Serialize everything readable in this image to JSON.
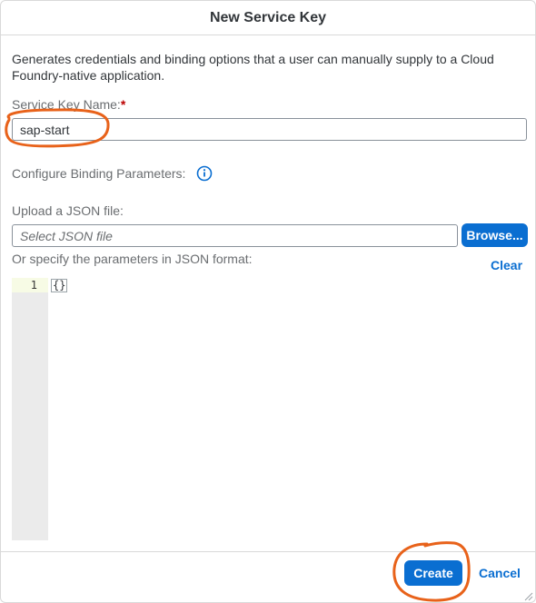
{
  "dialog": {
    "title": "New Service Key",
    "description": "Generates credentials and binding options that a user can manually supply to a Cloud Foundry-native application.",
    "service_key_name_label": "Service Key Name:",
    "required_marker": "*",
    "service_key_name_value": "sap-start",
    "binding_params_label": "Configure Binding Parameters:",
    "upload_label": "Upload a JSON file:",
    "file_placeholder": "Select JSON file",
    "browse_button": "Browse...",
    "specify_label": "Or specify the parameters in JSON format:",
    "clear_link": "Clear",
    "editor": {
      "line_numbers": [
        "1"
      ],
      "code": "{}"
    },
    "create_button": "Create",
    "cancel_button": "Cancel"
  },
  "colors": {
    "accent": "#0a6ed1",
    "annotation": "#e8621a",
    "required": "#bb0000"
  },
  "icons": {
    "info": "info-icon",
    "resize": "resize-handle-icon"
  }
}
